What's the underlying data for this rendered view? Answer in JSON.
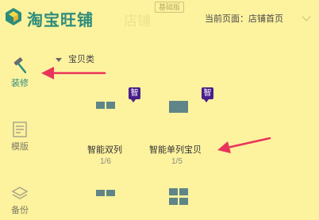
{
  "header": {
    "brand": "淘宝旺铺",
    "shop_ghost": "店铺",
    "edition_badge": "基础版",
    "current_page": "当前页面：店铺首页"
  },
  "sidebar": {
    "items": [
      {
        "label": "装修",
        "icon": "hammer-icon",
        "active": true
      },
      {
        "label": "模版",
        "icon": "template-icon",
        "active": false
      },
      {
        "label": "备份",
        "icon": "layers-icon",
        "active": false
      }
    ]
  },
  "category": {
    "label": "宝贝类"
  },
  "modules": [
    {
      "name": "智能双列",
      "count": "1/6",
      "badge": "智"
    },
    {
      "name": "智能单列宝贝",
      "count": "1/5",
      "badge": "智"
    }
  ],
  "colors": {
    "background": "#fdf29e",
    "accent": "#2c8c7c",
    "badge": "#4a1e8a",
    "module_block": "#5f8588",
    "annotation_arrow": "#e8345a"
  }
}
